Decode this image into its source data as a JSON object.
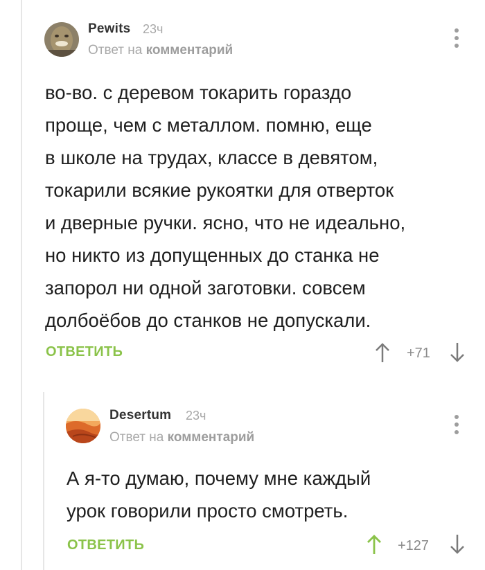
{
  "comments": [
    {
      "author": "Pewits",
      "time": "23ч",
      "reply_to_prefix": "Ответ на",
      "reply_to_target": "комментарий",
      "lines": [
        "во-во. с деревом токарить гораздо",
        "проще, чем с металлом. помню, еще",
        "в школе на трудах, классе в девятом,",
        "токарили всякие рукоятки для отверток",
        "и дверные ручки. ясно, что не идеально,",
        "но никто из допущенных до станка не",
        "запорол ни одной заготовки. совсем",
        "долбоёбов до станков не допускали."
      ],
      "reply_label": "ОТВЕТИТЬ",
      "rating": "+71"
    },
    {
      "author": "Desertum",
      "time": "23ч",
      "reply_to_prefix": "Ответ на",
      "reply_to_target": "комментарий",
      "lines": [
        "А я-то думаю, почему мне каждый",
        "урок говорили просто смотреть."
      ],
      "reply_label": "ОТВЕТИТЬ",
      "rating": "+127"
    }
  ],
  "colors": {
    "accent_green": "#8bc34a",
    "muted_grey": "#a8a8a8",
    "thread_line": "#e6e6e6"
  }
}
